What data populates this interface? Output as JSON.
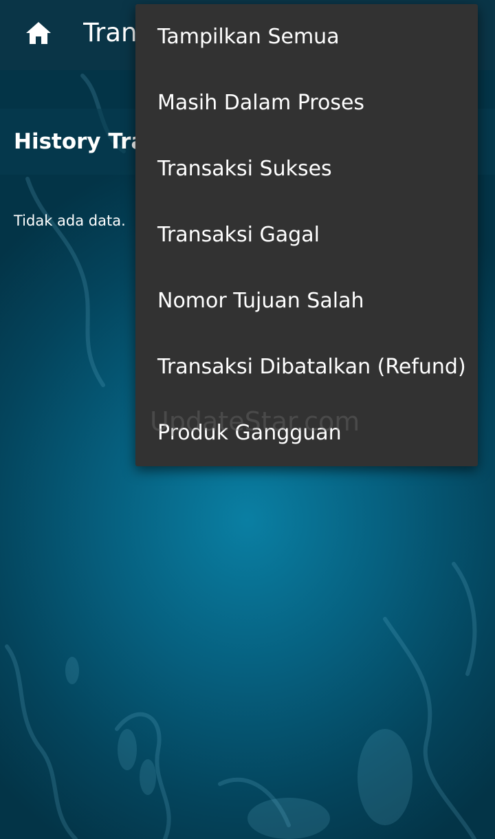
{
  "appbar": {
    "title": "Tran",
    "home_icon": "home-icon"
  },
  "section": {
    "title": "History Tra"
  },
  "content": {
    "empty_message": "Tidak ada data."
  },
  "menu": {
    "items": [
      {
        "label": "Tampilkan Semua"
      },
      {
        "label": "Masih Dalam Proses"
      },
      {
        "label": "Transaksi Sukses"
      },
      {
        "label": "Transaksi Gagal"
      },
      {
        "label": "Nomor Tujuan Salah"
      },
      {
        "label": "Transaksi Dibatalkan (Refund)"
      },
      {
        "label": "Produk Gangguan"
      }
    ]
  },
  "watermark": "UpdateStar.com",
  "colors": {
    "appbar": "#0a3547",
    "menu_background": "#323232",
    "background": "#06607f"
  }
}
